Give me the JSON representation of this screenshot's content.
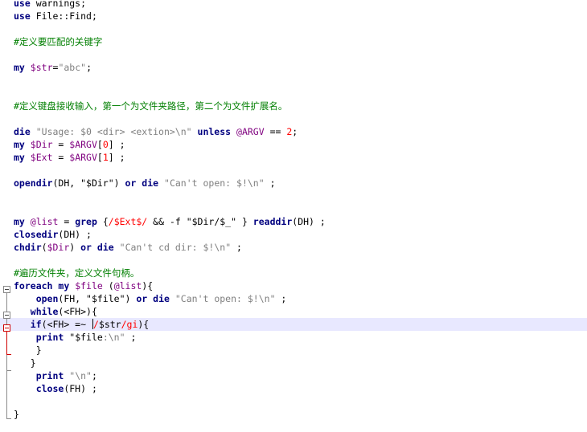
{
  "editor": {
    "colors": {
      "keyword": "#00007f",
      "plain": "#000000",
      "comment": "#007f00",
      "variable": "#7f007f",
      "string": "#7f7f7f",
      "number": "#ff0000",
      "regex": "#ff0000",
      "current_line": "#e8e8ff",
      "fold_marker_active": "#d00000"
    },
    "lines": [
      {
        "segs": [
          [
            "use",
            "keyword"
          ],
          [
            " warnings;",
            "plain"
          ]
        ]
      },
      {
        "segs": [
          [
            "use",
            "keyword"
          ],
          [
            " File::Find;",
            "plain"
          ]
        ]
      },
      {
        "segs": []
      },
      {
        "segs": [
          [
            "#定义要匹配的关键字",
            "comment"
          ]
        ]
      },
      {
        "segs": []
      },
      {
        "segs": [
          [
            "my",
            "keyword"
          ],
          [
            " ",
            "plain"
          ],
          [
            "$str",
            "variable"
          ],
          [
            "=",
            "plain"
          ],
          [
            "\"abc\"",
            "string"
          ],
          [
            ";",
            "plain"
          ]
        ]
      },
      {
        "segs": []
      },
      {
        "segs": []
      },
      {
        "segs": [
          [
            "#定义键盘接收输入，第一个为文件夹路径，第二个为文件扩展名。",
            "comment"
          ]
        ]
      },
      {
        "segs": []
      },
      {
        "segs": [
          [
            "die",
            "keyword"
          ],
          [
            " ",
            "plain"
          ],
          [
            "\"Usage: $0 <dir> <extion>\\n\"",
            "string"
          ],
          [
            " ",
            "plain"
          ],
          [
            "unless",
            "keyword"
          ],
          [
            " ",
            "plain"
          ],
          [
            "@ARGV",
            "variable"
          ],
          [
            " == ",
            "plain"
          ],
          [
            "2",
            "number"
          ],
          [
            ";",
            "plain"
          ]
        ]
      },
      {
        "segs": [
          [
            "my",
            "keyword"
          ],
          [
            " ",
            "plain"
          ],
          [
            "$Dir",
            "variable"
          ],
          [
            " = ",
            "plain"
          ],
          [
            "$ARGV",
            "variable"
          ],
          [
            "[",
            "plain"
          ],
          [
            "0",
            "number"
          ],
          [
            "] ;",
            "plain"
          ]
        ]
      },
      {
        "segs": [
          [
            "my",
            "keyword"
          ],
          [
            " ",
            "plain"
          ],
          [
            "$Ext",
            "variable"
          ],
          [
            " = ",
            "plain"
          ],
          [
            "$ARGV",
            "variable"
          ],
          [
            "[",
            "plain"
          ],
          [
            "1",
            "number"
          ],
          [
            "] ;",
            "plain"
          ]
        ]
      },
      {
        "segs": []
      },
      {
        "segs": [
          [
            "opendir",
            "keyword"
          ],
          [
            "(DH, ",
            "plain"
          ],
          [
            "\"$Dir\"",
            "plain"
          ],
          [
            ") ",
            "plain"
          ],
          [
            "or",
            "keyword"
          ],
          [
            " ",
            "plain"
          ],
          [
            "die",
            "keyword"
          ],
          [
            " ",
            "plain"
          ],
          [
            "\"Can't open: $!\\n\"",
            "string"
          ],
          [
            " ;",
            "plain"
          ]
        ]
      },
      {
        "segs": []
      },
      {
        "segs": []
      },
      {
        "segs": [
          [
            "my",
            "keyword"
          ],
          [
            " ",
            "plain"
          ],
          [
            "@list",
            "variable"
          ],
          [
            " = ",
            "plain"
          ],
          [
            "grep",
            "keyword"
          ],
          [
            " {",
            "plain"
          ],
          [
            "/$Ext$/",
            "regex"
          ],
          [
            " && -f ",
            "plain"
          ],
          [
            "\"$Dir/$_\"",
            "plain"
          ],
          [
            " } ",
            "plain"
          ],
          [
            "readdir",
            "keyword"
          ],
          [
            "(DH) ;",
            "plain"
          ]
        ]
      },
      {
        "segs": [
          [
            "closedir",
            "keyword"
          ],
          [
            "(DH) ;",
            "plain"
          ]
        ]
      },
      {
        "segs": [
          [
            "chdir",
            "keyword"
          ],
          [
            "(",
            "plain"
          ],
          [
            "$Dir",
            "variable"
          ],
          [
            ") ",
            "plain"
          ],
          [
            "or",
            "keyword"
          ],
          [
            " ",
            "plain"
          ],
          [
            "die",
            "keyword"
          ],
          [
            " ",
            "plain"
          ],
          [
            "\"Can't cd dir: $!\\n\"",
            "string"
          ],
          [
            " ;",
            "plain"
          ]
        ]
      },
      {
        "segs": []
      },
      {
        "segs": [
          [
            "#遍历文件夹，定义文件句柄。",
            "comment"
          ]
        ]
      },
      {
        "segs": [
          [
            "foreach",
            "keyword"
          ],
          [
            " ",
            "plain"
          ],
          [
            "my",
            "keyword"
          ],
          [
            " ",
            "plain"
          ],
          [
            "$file",
            "variable"
          ],
          [
            " (",
            "plain"
          ],
          [
            "@list",
            "variable"
          ],
          [
            "){",
            "plain"
          ]
        ]
      },
      {
        "segs": [
          [
            "    ",
            "plain"
          ],
          [
            "open",
            "keyword"
          ],
          [
            "(FH, ",
            "plain"
          ],
          [
            "\"$file\"",
            "plain"
          ],
          [
            ") ",
            "plain"
          ],
          [
            "or",
            "keyword"
          ],
          [
            " ",
            "plain"
          ],
          [
            "die",
            "keyword"
          ],
          [
            " ",
            "plain"
          ],
          [
            "\"Can't open: $!\\n\"",
            "string"
          ],
          [
            " ;",
            "plain"
          ]
        ]
      },
      {
        "segs": [
          [
            "   ",
            "plain"
          ],
          [
            "while",
            "keyword"
          ],
          [
            "(<FH>){",
            "plain"
          ]
        ]
      },
      {
        "segs": [
          [
            "   ",
            "plain"
          ],
          [
            "if",
            "keyword"
          ],
          [
            "(<FH> =~ ",
            "plain"
          ],
          [
            "/",
            "regex"
          ],
          [
            "$str",
            "plain"
          ],
          [
            "/gi",
            "regex"
          ],
          [
            "){",
            "plain"
          ]
        ]
      },
      {
        "segs": [
          [
            "    ",
            "plain"
          ],
          [
            "print",
            "keyword"
          ],
          [
            " ",
            "plain"
          ],
          [
            "\"$file",
            "plain"
          ],
          [
            ":\\n\"",
            "string"
          ],
          [
            " ;",
            "plain"
          ]
        ]
      },
      {
        "segs": [
          [
            "    }",
            "plain"
          ]
        ]
      },
      {
        "segs": [
          [
            "   }",
            "plain"
          ]
        ]
      },
      {
        "segs": [
          [
            "    ",
            "plain"
          ],
          [
            "print",
            "keyword"
          ],
          [
            " ",
            "plain"
          ],
          [
            "\"\\n\"",
            "string"
          ],
          [
            ";",
            "plain"
          ]
        ]
      },
      {
        "segs": [
          [
            "    ",
            "plain"
          ],
          [
            "close",
            "keyword"
          ],
          [
            "(FH) ;",
            "plain"
          ]
        ]
      },
      {
        "segs": []
      },
      {
        "segs": [
          [
            "}",
            "plain"
          ]
        ]
      }
    ]
  }
}
